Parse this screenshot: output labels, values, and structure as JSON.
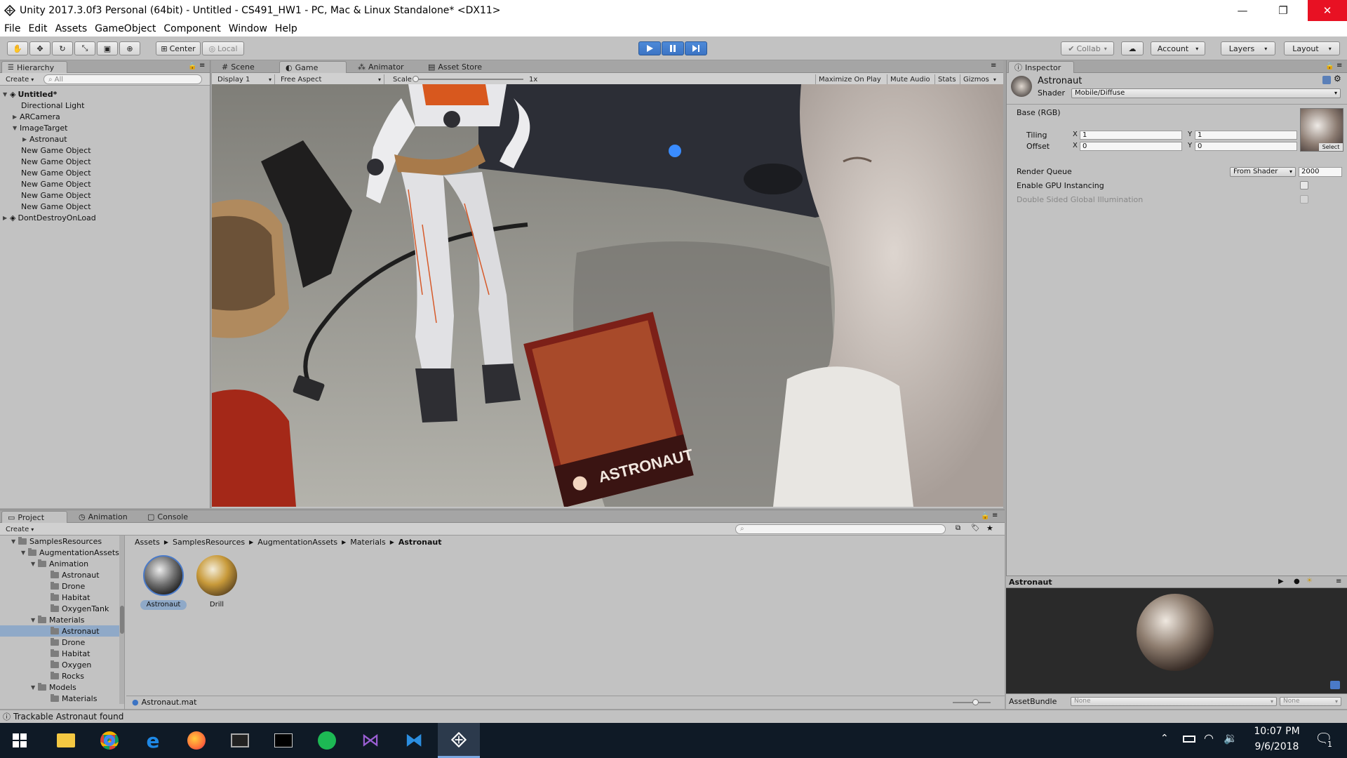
{
  "window": {
    "title": "Unity 2017.3.0f3 Personal (64bit) - Untitled - CS491_HW1 - PC, Mac & Linux Standalone* <DX11>",
    "minimize": "—",
    "maximize": "❐",
    "close": "✕"
  },
  "menu": [
    "File",
    "Edit",
    "Assets",
    "GameObject",
    "Component",
    "Window",
    "Help"
  ],
  "toolbar": {
    "pivot_center": "Center",
    "pivot_local": "Local",
    "collab": "Collab",
    "account": "Account",
    "layers": "Layers",
    "layout": "Layout"
  },
  "hierarchy": {
    "tab": "Hierarchy",
    "create": "Create",
    "search_placeholder": "All",
    "scene": "Untitled*",
    "items": [
      "Directional Light",
      "ARCamera",
      "ImageTarget",
      "Astronaut",
      "New Game Object",
      "New Game Object",
      "New Game Object",
      "New Game Object",
      "New Game Object",
      "New Game Object"
    ],
    "dont_destroy": "DontDestroyOnLoad"
  },
  "game_view": {
    "tabs": [
      "Scene",
      "Game",
      "Animator",
      "Asset Store"
    ],
    "display": "Display 1",
    "aspect": "Free Aspect",
    "scale_label": "Scale",
    "scale_value": "1x",
    "maximize": "Maximize On Play",
    "mute": "Mute Audio",
    "stats": "Stats",
    "gizmos": "Gizmos",
    "card_text": "ASTRONAUT"
  },
  "inspector": {
    "tab": "Inspector",
    "name": "Astronaut",
    "shader_label": "Shader",
    "shader_value": "Mobile/Diffuse",
    "base_label": "Base (RGB)",
    "tiling_label": "Tiling",
    "offset_label": "Offset",
    "x": "X",
    "y": "Y",
    "tiling_x": "1",
    "tiling_y": "1",
    "offset_x": "0",
    "offset_y": "0",
    "select": "Select",
    "render_queue_label": "Render Queue",
    "render_queue_mode": "From Shader",
    "render_queue_value": "2000",
    "gpu_instancing": "Enable GPU Instancing",
    "double_sided": "Double Sided Global Illumination",
    "preview_title": "Astronaut",
    "asset_bundle_label": "AssetBundle",
    "asset_bundle_value": "None",
    "asset_bundle_variant": "None"
  },
  "project": {
    "tabs": [
      "Project",
      "Animation",
      "Console"
    ],
    "create": "Create",
    "breadcrumb": [
      "Assets",
      "SamplesResources",
      "AugmentationAssets",
      "Materials",
      "Astronaut"
    ],
    "tree": [
      "SamplesResources",
      "AugmentationAssets",
      "Animation",
      "Astronaut",
      "Drone",
      "Habitat",
      "OxygenTank",
      "Materials",
      "Astronaut",
      "Drone",
      "Habitat",
      "Oxygen",
      "Rocks",
      "Models",
      "Materials"
    ],
    "assets": [
      "Astronaut",
      "Drill"
    ],
    "selected_file": "Astronaut.mat"
  },
  "status": "Trackable Astronaut found",
  "taskbar": {
    "time": "10:07 PM",
    "date": "9/6/2018",
    "notifications": "1"
  },
  "colors": {
    "accent": "#3c74c4",
    "panel": "#c2c2c2",
    "taskbar": "#0f1a26",
    "selection": "#8fa9c8"
  }
}
